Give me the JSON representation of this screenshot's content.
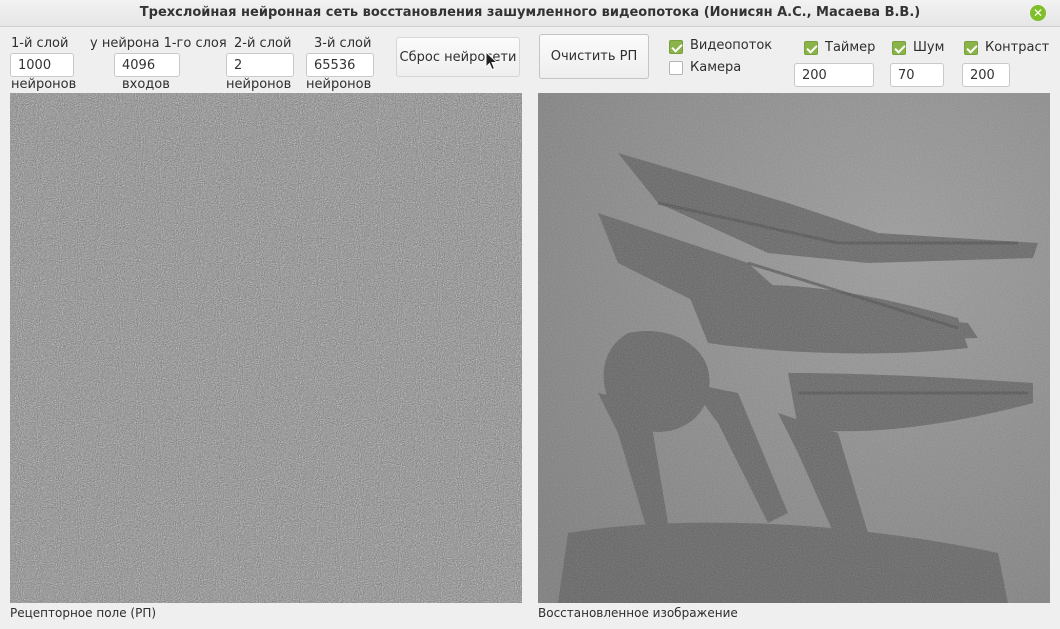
{
  "window": {
    "title": "Трехслойная нейронная сеть восстановления зашумленного видеопотока (Ионисян А.С., Масаева В.В.)",
    "close_icon": "close-icon"
  },
  "layer1": {
    "label": "1-й слой",
    "value": "1000",
    "unit": "нейронов"
  },
  "inputs": {
    "label": "у нейрона 1-го слоя",
    "value": "4096",
    "unit": "входов"
  },
  "layer2": {
    "label": "2-й слой",
    "value": "2",
    "unit": "нейронов"
  },
  "layer3": {
    "label": "3-й слой",
    "value": "65536",
    "unit": "нейронов"
  },
  "buttons": {
    "reset": "Сброс нейросети",
    "clear": "Очистить РП"
  },
  "checks": {
    "video": {
      "label": "Видеопоток",
      "checked": true
    },
    "camera": {
      "label": "Камера",
      "checked": false
    },
    "timer": {
      "label": "Таймер",
      "checked": true,
      "value": "200"
    },
    "noise": {
      "label": "Шум",
      "checked": true,
      "value": "70"
    },
    "contrast": {
      "label": "Контраст",
      "checked": true,
      "value": "200"
    }
  },
  "panels": {
    "receptor_caption": "Рецепторное поле (РП)",
    "restored_caption": "Восстановленное изображение"
  },
  "colors": {
    "accent": "#8ab34a",
    "close": "#7fbf2a"
  }
}
